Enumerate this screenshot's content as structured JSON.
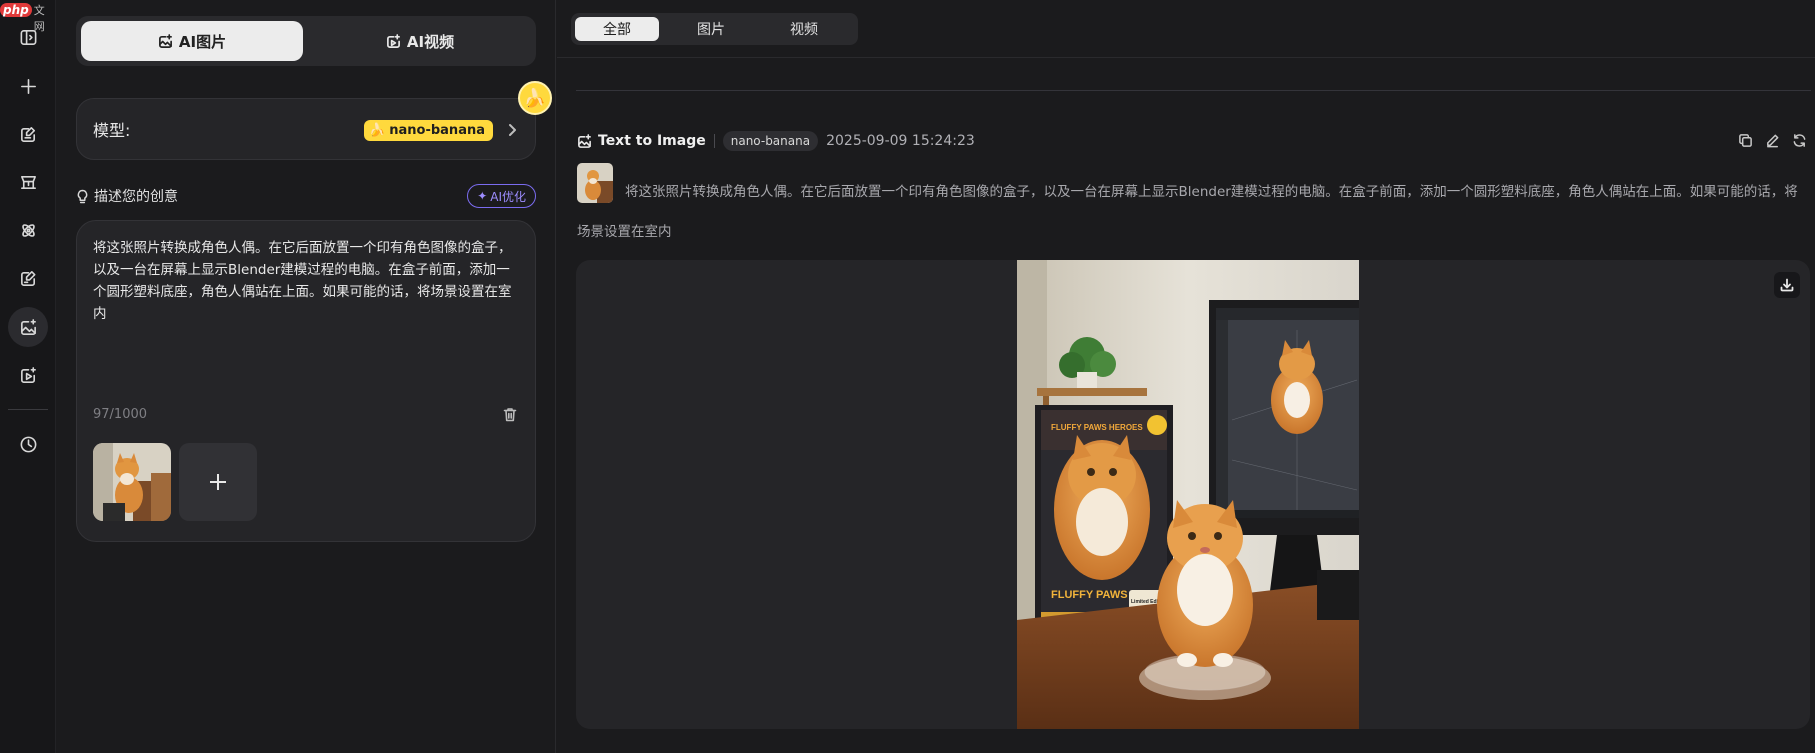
{
  "watermark": {
    "brand": "php",
    "site": "中文网"
  },
  "mode_tabs": {
    "image": "AI图片",
    "video": "AI视频",
    "active": "image"
  },
  "model": {
    "label": "模型:",
    "name": "nano-banana",
    "badge_color": "#ffd93d"
  },
  "prompt": {
    "heading": "描述您的创意",
    "optimize_label": "AI优化",
    "text": "将这张照片转换成角色人偶。在它后面放置一个印有角色图像的盒子，以及一台在屏幕上显示Blender建模过程的电脑。在盒子前面，添加一个圆形塑料底座，角色人偶站在上面。如果可能的话，将场景设置在室内",
    "count": "97/1000"
  },
  "filter_tabs": {
    "all": "全部",
    "images": "图片",
    "videos": "视频",
    "active": "all"
  },
  "generation": {
    "type_label": "Text to Image",
    "model": "nano-banana",
    "timestamp": "2025-09-09 15:24:23",
    "prompt": "将这张照片转换成角色人偶。在它后面放置一个印有角色图像的盒子，以及一台在屏幕上显示Blender建模过程的电脑。在盒子前面，添加一个圆形塑料底座，角色人偶站在上面。如果可能的话，将场景设置在室内"
  },
  "box_art": {
    "top_text": "FLUFFY PAWS HEROES",
    "bottom_text": "FLUFFY PAWS",
    "sticker": "Limited Edition"
  },
  "colors": {
    "accent_purple": "#7b6cf0",
    "banana_yellow": "#ffd93d",
    "background": "#1b1b1d"
  },
  "icons": [
    "sidebar-toggle-icon",
    "plus-icon",
    "chat-edit-icon",
    "scene-icon",
    "atom-icon",
    "edit-doc-icon",
    "image-ai-icon",
    "video-icon",
    "history-icon",
    "trash-icon",
    "download-icon",
    "copy-icon",
    "edit-icon",
    "refresh-icon"
  ]
}
